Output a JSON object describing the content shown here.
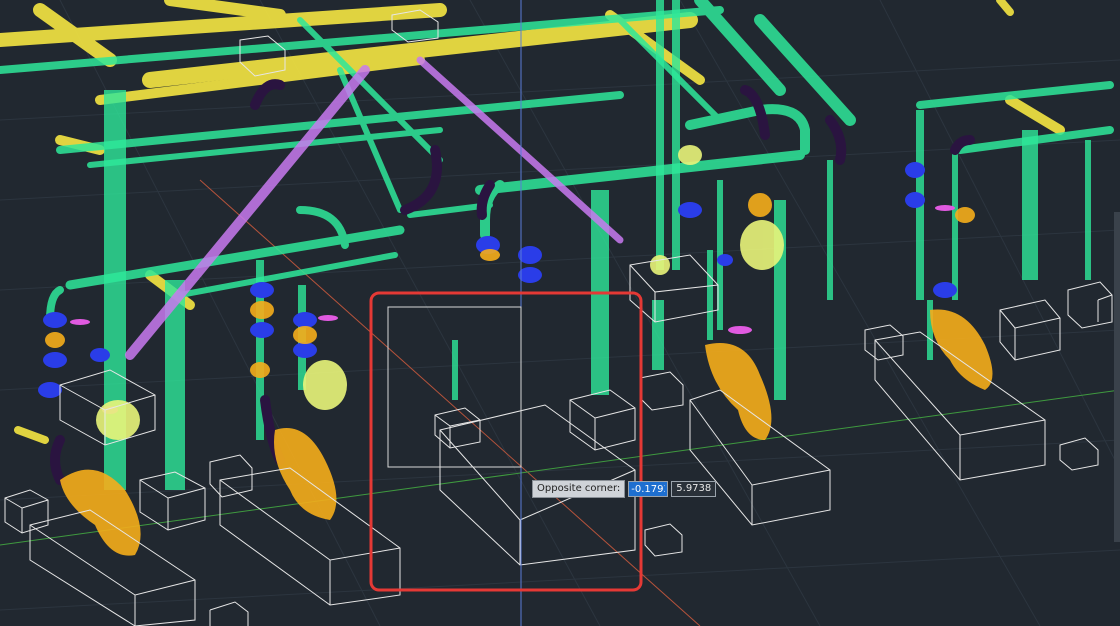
{
  "viewport": {
    "background": "#212830",
    "grid_color": "#2e3741",
    "selection_window_color": "#d8d8d8",
    "highlight_color": "#e53935",
    "crosshair_color": "#5a7bd8"
  },
  "prompt": {
    "label": "Opposite corner:",
    "x_value": "-0.1793",
    "y_value": "5.9738"
  },
  "pointcloud_colors": {
    "pipe_green": "#2ee89a",
    "structure_yellow": "#f5e642",
    "valve_orange": "#f5ad1b",
    "flange_blue": "#2a3de8",
    "purple_brace": "#c87af0",
    "dark_elbow": "#2a1440",
    "lime_tank": "#e9f57a",
    "box_outline": "#e6e6e6"
  }
}
